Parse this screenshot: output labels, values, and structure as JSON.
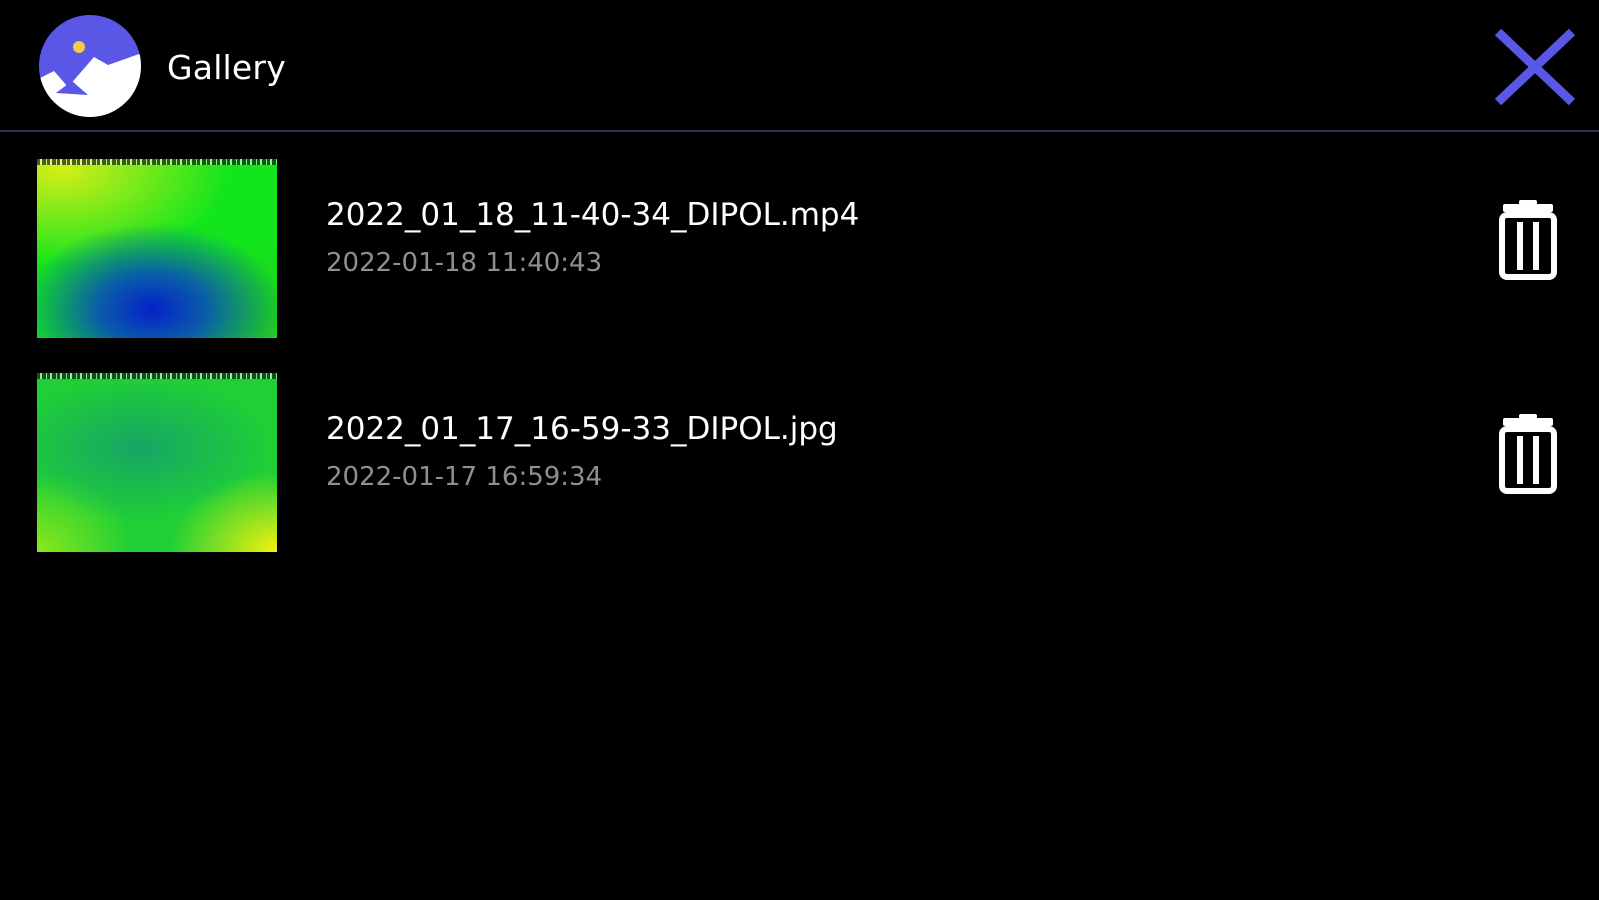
{
  "header": {
    "title": "Gallery",
    "app_icon": "gallery-app-icon",
    "close_icon": "close-icon",
    "accent_color": "#5b57e6"
  },
  "files": [
    {
      "name": "2022_01_18_11-40-34_DIPOL.mp4",
      "date": "2022-01-18 11:40:43",
      "delete_icon": "trash-icon"
    },
    {
      "name": "2022_01_17_16-59-33_DIPOL.jpg",
      "date": "2022-01-17 16:59:34",
      "delete_icon": "trash-icon"
    }
  ],
  "colors": {
    "background": "#000000",
    "text_primary": "#ffffff",
    "text_secondary": "#8f8f8f",
    "divider": "#2f2a57"
  }
}
